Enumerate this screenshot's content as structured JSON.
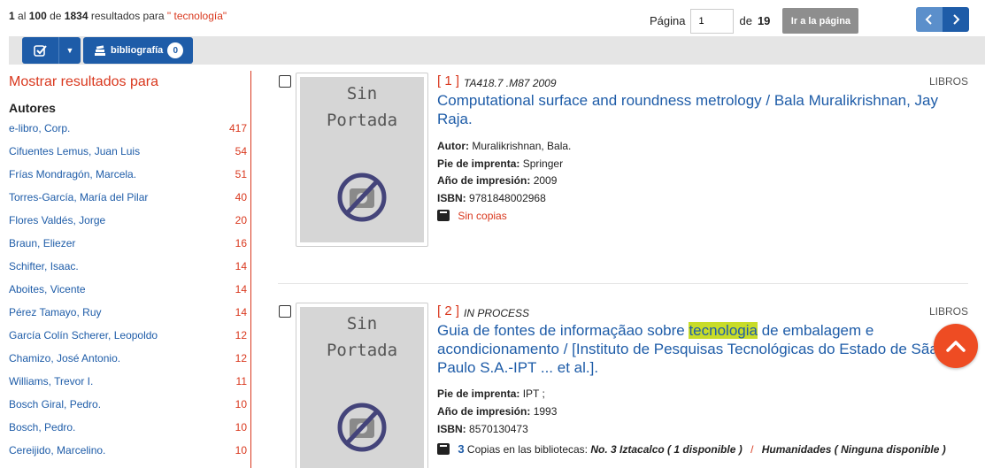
{
  "summary": {
    "from": "1",
    "al": "al",
    "to": "100",
    "de": "de",
    "total": "1834",
    "text": "resultados para",
    "query": "\" tecnología\""
  },
  "pagination": {
    "label": "Página",
    "current": "1",
    "of_label": "de",
    "total_pages": "19",
    "goto_label": "Ir a la página"
  },
  "toolbar": {
    "bibliography_label": "bibliografía",
    "bibliography_count": "0"
  },
  "sidebar": {
    "title": "Mostrar resultados para",
    "facet_title": "Autores",
    "authors": [
      {
        "name": "e-libro, Corp.",
        "count": "417"
      },
      {
        "name": "Cifuentes Lemus, Juan Luis",
        "count": "54"
      },
      {
        "name": "Frías Mondragón, Marcela.",
        "count": "51"
      },
      {
        "name": "Torres-García, María del Pilar",
        "count": "40"
      },
      {
        "name": "Flores Valdés, Jorge",
        "count": "20"
      },
      {
        "name": "Braun, Eliezer",
        "count": "16"
      },
      {
        "name": "Schifter, Isaac.",
        "count": "14"
      },
      {
        "name": "Aboites, Vicente",
        "count": "14"
      },
      {
        "name": "Pérez Tamayo, Ruy",
        "count": "14"
      },
      {
        "name": "García Colín Scherer, Leopoldo",
        "count": "12"
      },
      {
        "name": "Chamizo, José Antonio.",
        "count": "12"
      },
      {
        "name": "Williams, Trevor I.",
        "count": "11"
      },
      {
        "name": "Bosch Giral, Pedro.",
        "count": "10"
      },
      {
        "name": "Bosch, Pedro.",
        "count": "10"
      },
      {
        "name": "Cereijido, Marcelino.",
        "count": "10"
      }
    ]
  },
  "cover_placeholder": {
    "line1": "Sin",
    "line2": "Portada"
  },
  "results": [
    {
      "number": "[ 1 ]",
      "call_number": "TA418.7 .M87 2009",
      "type": "LIBROS",
      "title": "Computational surface and roundness metrology / Bala Muralikrishnan, Jay Raja.",
      "author_label": "Autor:",
      "author": "Muralikrishnan, Bala.",
      "imprint_label": "Pie de imprenta:",
      "imprint": "Springer",
      "year_label": "Año de impresión:",
      "year": "2009",
      "isbn_label": "ISBN:",
      "isbn": "9781848002968",
      "availability": "Sin copias"
    },
    {
      "number": "[ 2 ]",
      "call_number": "IN PROCESS",
      "type": "LIBROS",
      "title_before": "Guia de fontes de informaçãao sobre ",
      "title_highlight": "tecnologia",
      "title_after": " de embalagem e acondicionamento / [Instituto de Pesquisas Tecnológicas do Estado de Sãao Paulo S.A.-IPT ... et al.].",
      "imprint_label": "Pie de imprenta:",
      "imprint": "IPT ;",
      "year_label": "Año de impresión:",
      "year": "1993",
      "isbn_label": "ISBN:",
      "isbn": "8570130473",
      "copies_count": "3",
      "copies_text": "Copias en las bibliotecas:",
      "library1": "No. 3 Iztacalco ( 1 disponible )",
      "separator": "/",
      "library2": "Humanidades ( Ninguna disponible )"
    }
  ],
  "colors": {
    "accent": "#d9381e",
    "link": "#1e5ca8",
    "highlight": "#c8dc28",
    "fab": "#ee4c23"
  }
}
